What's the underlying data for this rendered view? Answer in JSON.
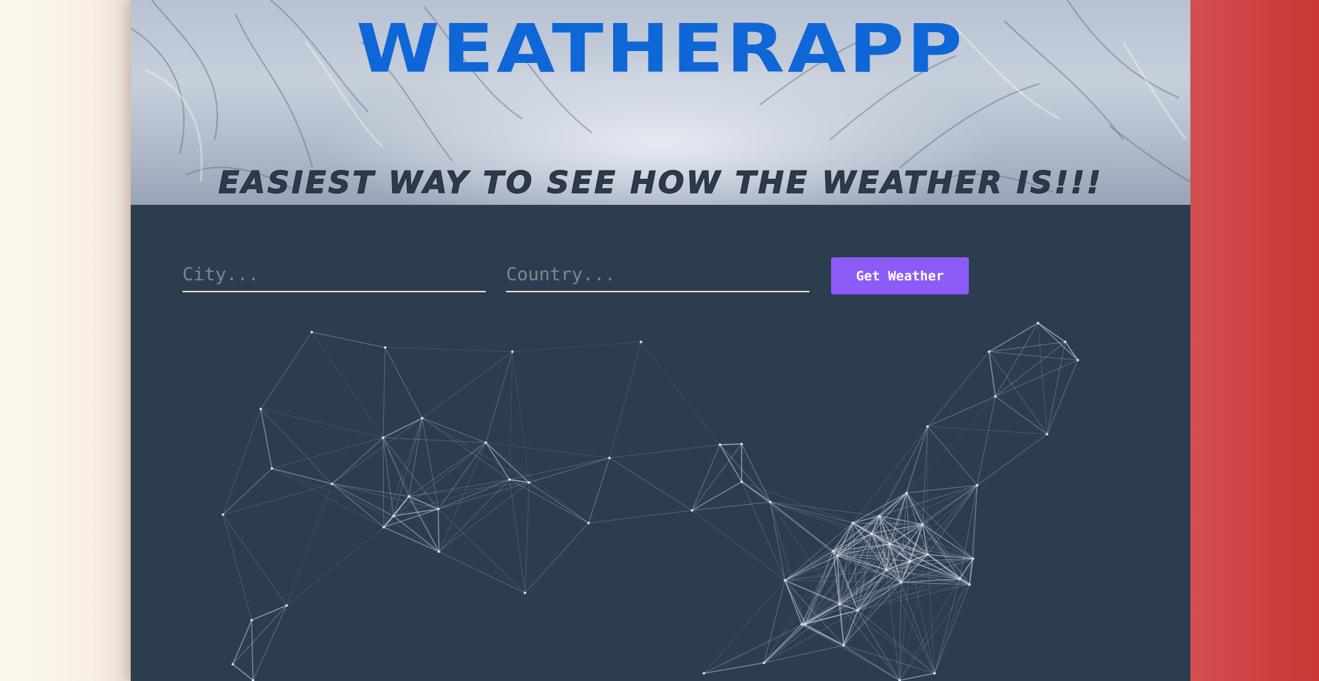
{
  "header": {
    "title": "WEATHERAPP",
    "tagline": "EASIEST WAY TO SEE HOW THE WEATHER IS!!!"
  },
  "search": {
    "city_placeholder": "City...",
    "country_placeholder": "Country...",
    "button_label": "Get Weather"
  },
  "colors": {
    "title": "#0f66d6",
    "panel_background": "#2d3d50",
    "button": "#8b5cf6",
    "input_underline": "#f0e6b0",
    "network_lines": "#c8d2de"
  },
  "icons": {
    "hero_background": "snowy-forest-image",
    "background_animation": "particle-network"
  }
}
